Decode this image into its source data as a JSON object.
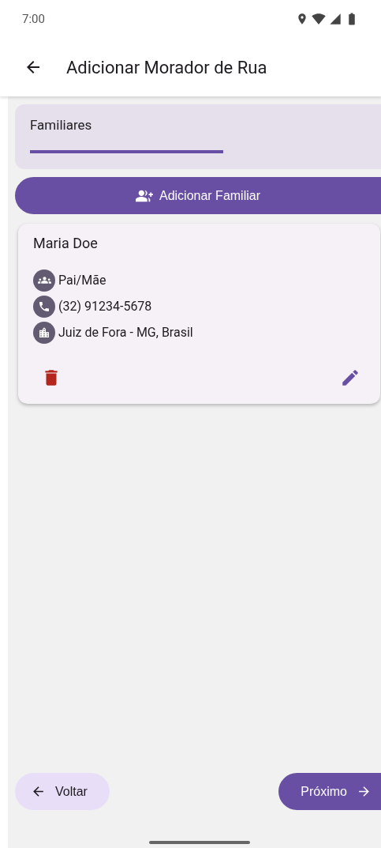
{
  "status_bar": {
    "time": "7:00"
  },
  "app_bar": {
    "title": "Adicionar Morador de Rua"
  },
  "section": {
    "title": "Familiares"
  },
  "add_button": {
    "label": "Adicionar Familiar"
  },
  "members": [
    {
      "name": "Maria Doe",
      "details": [
        {
          "kind": "relation",
          "text": "Pai/Mãe"
        },
        {
          "kind": "phone",
          "text": "(32) 91234-5678"
        },
        {
          "kind": "city",
          "text": "Juiz de Fora - MG, Brasil"
        }
      ]
    }
  ],
  "nav": {
    "back": "Voltar",
    "next": "Próximo"
  }
}
